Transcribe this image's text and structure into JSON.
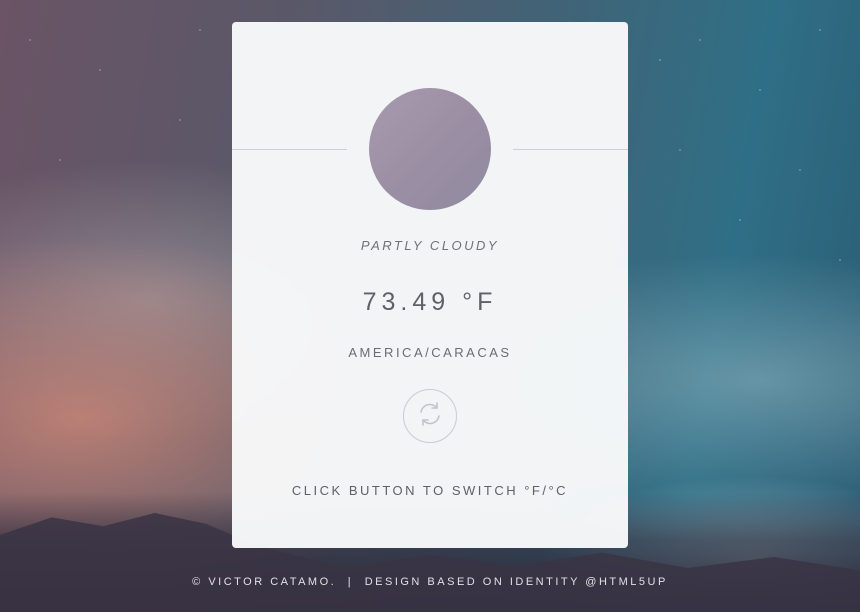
{
  "weather": {
    "condition": "PARTLY CLOUDY",
    "temperature": "73.49",
    "unit": "°F",
    "location": "AMERICA/CARACAS"
  },
  "switch_button": {
    "icon": "refresh-icon",
    "hint": "CLICK BUTTON TO SWITCH °F/°C"
  },
  "footer": {
    "credit": "© VICTOR CATAMO.",
    "separator": "|",
    "design": "DESIGN BASED ON IDENTITY @HTML5UP"
  },
  "colors": {
    "card": "#f8f9fa",
    "circle": "#9e92a8",
    "text": "#5e6169"
  }
}
